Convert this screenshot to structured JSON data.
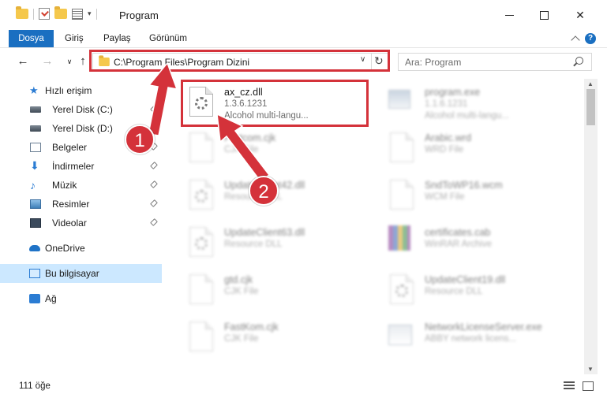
{
  "window": {
    "title": "Program"
  },
  "ribbon": {
    "tabs": [
      "Dosya",
      "Giriş",
      "Paylaş",
      "Görünüm"
    ]
  },
  "nav": {
    "address": "C:\\Program Files\\Program Dizini",
    "search_placeholder": "Ara: Program"
  },
  "sidebar": {
    "items": [
      {
        "label": "Hızlı erişim",
        "icon": "star-icon"
      },
      {
        "label": "Yerel Disk (C:)",
        "icon": "drive-icon"
      },
      {
        "label": "Yerel Disk (D:)",
        "icon": "drive-icon"
      },
      {
        "label": "Belgeler",
        "icon": "documents-icon"
      },
      {
        "label": "İndirmeler",
        "icon": "downloads-icon"
      },
      {
        "label": "Müzik",
        "icon": "music-icon"
      },
      {
        "label": "Resimler",
        "icon": "pictures-icon"
      },
      {
        "label": "Videolar",
        "icon": "videos-icon"
      },
      {
        "label": "OneDrive",
        "icon": "onedrive-icon"
      },
      {
        "label": "Bu bilgisayar",
        "icon": "computer-icon"
      },
      {
        "label": "Ağ",
        "icon": "network-icon"
      }
    ]
  },
  "files": [
    {
      "name": "ax_cz.dll",
      "line2": "1.3.6.1231",
      "line3": "Alcohol multi-langu...",
      "icon": "dll-gear-icon"
    },
    {
      "name": "program.exe",
      "line2": "1.1.6.1231",
      "line3": "Alcohol multi-langu...",
      "icon": "exe-icon"
    },
    {
      "name": "Portcom.cjk",
      "line2": "CJK File",
      "line3": "",
      "icon": "file-icon"
    },
    {
      "name": "Arabic.wrd",
      "line2": "WRD File",
      "line3": "",
      "icon": "file-icon"
    },
    {
      "name": "UpdateClient42.dll",
      "line2": "Resource DLL",
      "line3": "",
      "icon": "dll-gear-icon"
    },
    {
      "name": "SndToWP16.wcm",
      "line2": "WCM File",
      "line3": "",
      "icon": "file-icon"
    },
    {
      "name": "UpdateClient63.dll",
      "line2": "Resource DLL",
      "line3": "",
      "icon": "dll-gear-icon"
    },
    {
      "name": "certificates.cab",
      "line2": "WinRAR Archive",
      "line3": "",
      "icon": "winrar-icon"
    },
    {
      "name": "gtd.cjk",
      "line2": "CJK File",
      "line3": "",
      "icon": "file-icon"
    },
    {
      "name": "UpdateClient19.dll",
      "line2": "Resource DLL",
      "line3": "",
      "icon": "dll-gear-icon"
    },
    {
      "name": "FastKom.cjk",
      "line2": "CJK File",
      "line3": "",
      "icon": "file-icon"
    },
    {
      "name": "NetworkLicenseServer.exe",
      "line2": "ABBY network licens...",
      "line3": "",
      "icon": "network-exe-icon"
    }
  ],
  "status": {
    "count": "111 öğe"
  },
  "annotations": {
    "badge1": "1",
    "badge2": "2",
    "color": "#d4323a"
  }
}
